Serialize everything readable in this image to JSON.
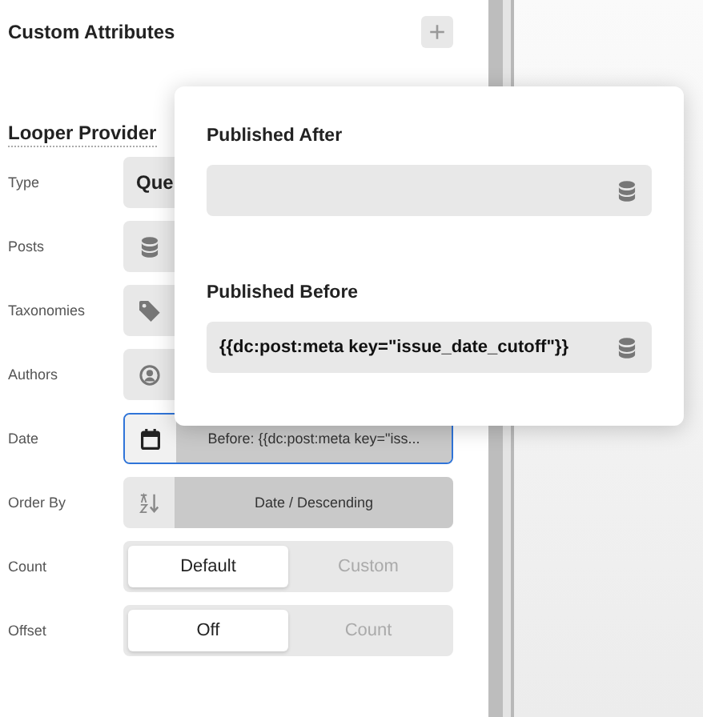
{
  "sidebar": {
    "custom_attributes": {
      "title": "Custom Attributes",
      "add_button": "+"
    },
    "looper_provider": {
      "title": "Looper Provider",
      "rows": [
        {
          "label": "Type",
          "kind": "select",
          "value": "Que"
        },
        {
          "label": "Posts",
          "kind": "picker"
        },
        {
          "label": "Taxonomies",
          "kind": "picker"
        },
        {
          "label": "Authors",
          "kind": "picker"
        },
        {
          "label": "Date",
          "kind": "picker",
          "value": "Before: {{dc:post:meta key=\"iss...",
          "focused": true
        },
        {
          "label": "Order By",
          "kind": "picker",
          "value": "Date / Descending",
          "focused": false
        },
        {
          "label": "Count",
          "kind": "segmented",
          "options": [
            {
              "label": "Default",
              "selected": true
            },
            {
              "label": "Custom",
              "selected": false
            }
          ]
        },
        {
          "label": "Offset",
          "kind": "segmented",
          "options": [
            {
              "label": "Off",
              "selected": true
            },
            {
              "label": "Count",
              "selected": false
            }
          ]
        }
      ]
    }
  },
  "popover": {
    "fields": [
      {
        "label": "Published After"
      },
      {
        "label": "Published Before",
        "value": "{{dc:post:meta key=\"issue_date_cutoff\"}}"
      }
    ]
  }
}
